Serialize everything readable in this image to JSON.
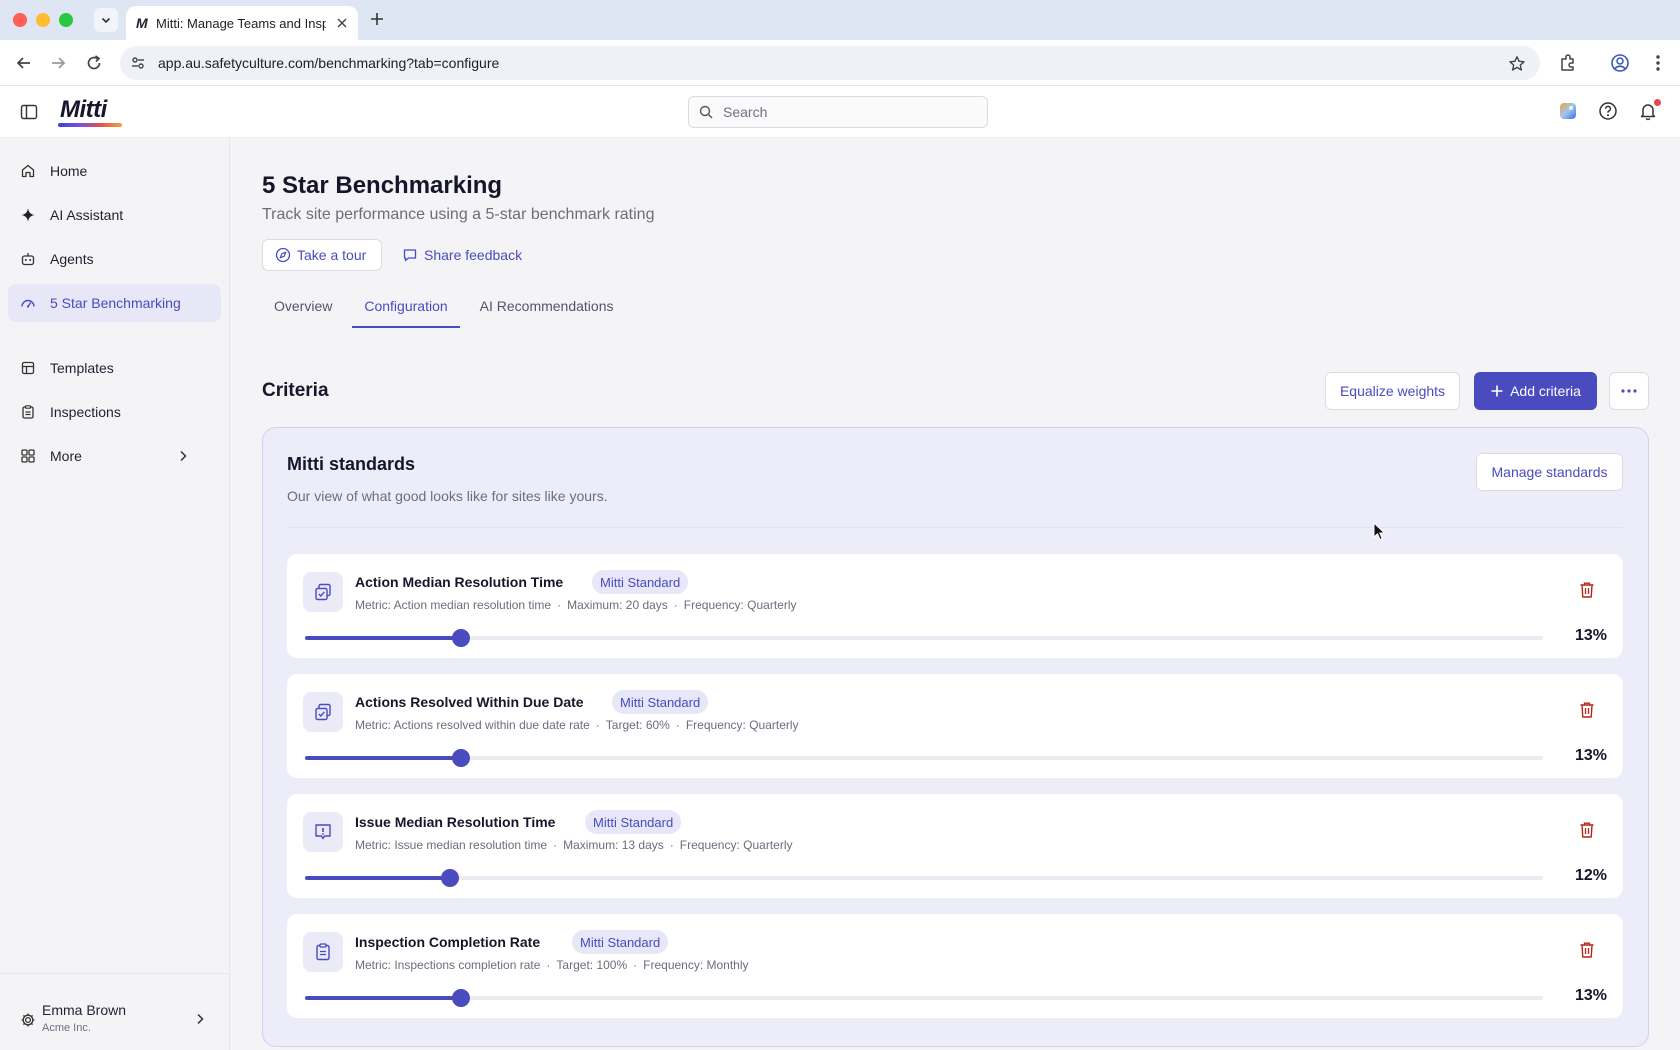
{
  "browser": {
    "tab_title": "Mitti: Manage Teams and Insp",
    "favicon": "M",
    "url": "app.au.safetyculture.com/benchmarking?tab=configure"
  },
  "header": {
    "logo": "Mitti",
    "search_placeholder": "Search"
  },
  "sidebar": {
    "items": [
      {
        "label": "Home",
        "icon": "home-icon"
      },
      {
        "label": "AI Assistant",
        "icon": "sparkle-icon"
      },
      {
        "label": "Agents",
        "icon": "robot-icon"
      },
      {
        "label": "5 Star Benchmarking",
        "icon": "gauge-icon",
        "active": true
      },
      {
        "label": "Templates",
        "icon": "template-icon"
      },
      {
        "label": "Inspections",
        "icon": "clipboard-icon"
      },
      {
        "label": "More",
        "icon": "grid-icon"
      }
    ],
    "user": {
      "name": "Emma Brown",
      "org": "Acme Inc."
    }
  },
  "page": {
    "title": "5 Star Benchmarking",
    "subtitle": "Track site performance using a 5-star benchmark rating",
    "tour_label": "Take a tour",
    "feedback_label": "Share feedback",
    "tabs": [
      "Overview",
      "Configuration",
      "AI Recommendations"
    ],
    "active_tab": "Configuration"
  },
  "criteria": {
    "heading": "Criteria",
    "equalize_label": "Equalize weights",
    "add_label": "Add criteria",
    "standards": {
      "title": "Mitti standards",
      "description": "Our view of what good looks like for sites like yours.",
      "manage_label": "Manage standards"
    },
    "items": [
      {
        "name": "Action Median Resolution Time",
        "badge": "Mitti Standard",
        "metric": "Metric: Action median resolution time",
        "limit": "Maximum: 20 days",
        "frequency": "Frequency: Quarterly",
        "weight": "13%",
        "slider_fraction": 0.126,
        "icon": "actions-icon"
      },
      {
        "name": "Actions Resolved Within Due Date",
        "badge": "Mitti Standard",
        "metric": "Metric: Actions resolved within due date rate",
        "limit": "Target: 60%",
        "frequency": "Frequency: Quarterly",
        "weight": "13%",
        "slider_fraction": 0.126,
        "icon": "actions-icon"
      },
      {
        "name": "Issue Median Resolution Time",
        "badge": "Mitti Standard",
        "metric": "Metric: Issue median resolution time",
        "limit": "Maximum: 13 days",
        "frequency": "Frequency: Quarterly",
        "weight": "12%",
        "slider_fraction": 0.117,
        "icon": "issue-icon"
      },
      {
        "name": "Inspection Completion Rate",
        "badge": "Mitti Standard",
        "metric": "Metric: Inspections completion rate",
        "limit": "Target: 100%",
        "frequency": "Frequency: Monthly",
        "weight": "13%",
        "slider_fraction": 0.126,
        "icon": "clipboard-icon"
      }
    ]
  },
  "colors": {
    "accent": "#4a4bbf",
    "danger": "#b3261e"
  }
}
